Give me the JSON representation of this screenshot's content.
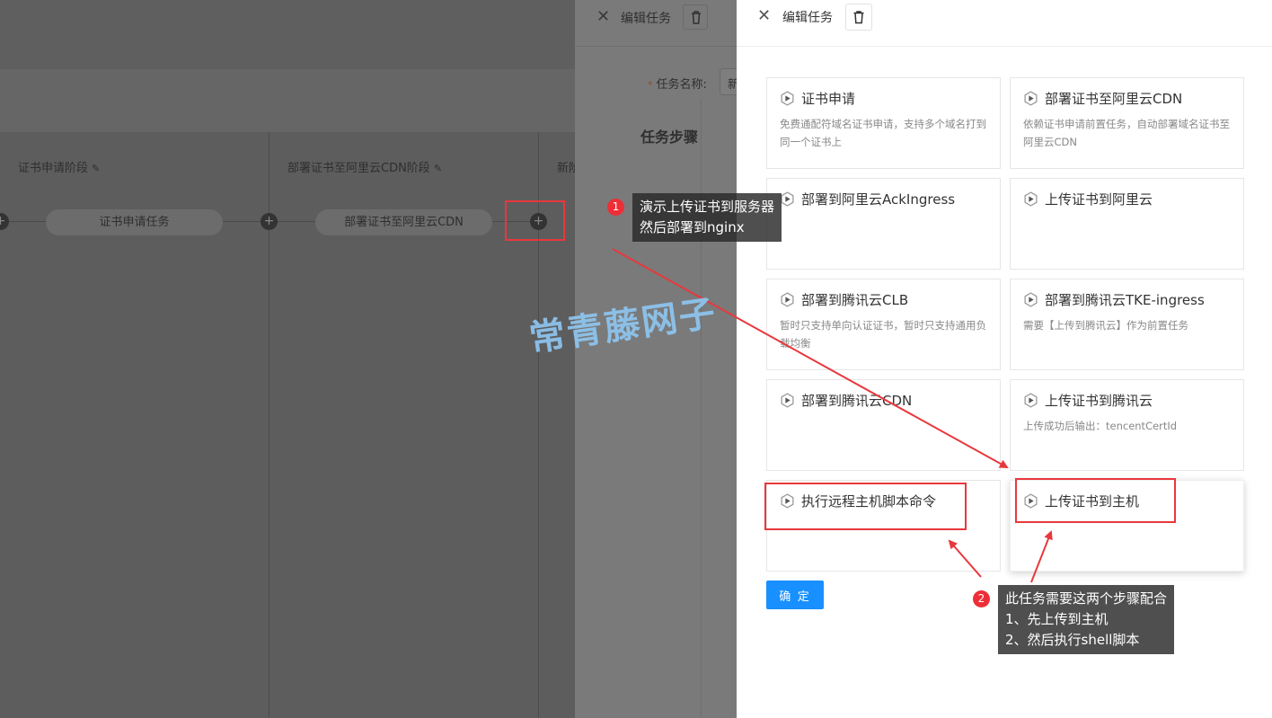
{
  "pipeline": {
    "stages": [
      {
        "title": "证书申请阶段",
        "node": "证书申请任务"
      },
      {
        "title": "部署证书至阿里云CDN阶段",
        "node": "部署证书至阿里云CDN"
      },
      {
        "title": "新阶段"
      }
    ],
    "add_symbol": "+",
    "edit_symbol": "✎"
  },
  "mid_drawer": {
    "title": "编辑任务",
    "task_name_label": "任务名称:",
    "task_name_value": "新",
    "steps_title": "任务步骤"
  },
  "drawer": {
    "title": "编辑任务",
    "cards": [
      {
        "title": "证书申请",
        "desc": "免费通配符域名证书申请，支持多个域名打到同一个证书上"
      },
      {
        "title": "部署证书至阿里云CDN",
        "desc": "依赖证书申请前置任务，自动部署域名证书至阿里云CDN"
      },
      {
        "title": "部署到阿里云AckIngress",
        "desc": ""
      },
      {
        "title": "上传证书到阿里云",
        "desc": ""
      },
      {
        "title": "部署到腾讯云CLB",
        "desc": "暂时只支持单向认证证书，暂时只支持通用负载均衡"
      },
      {
        "title": "部署到腾讯云TKE-ingress",
        "desc": "需要【上传到腾讯云】作为前置任务"
      },
      {
        "title": "部署到腾讯云CDN",
        "desc": ""
      },
      {
        "title": "上传证书到腾讯云",
        "desc": "上传成功后输出：tencentCertId"
      },
      {
        "title": "执行远程主机脚本命令",
        "desc": ""
      },
      {
        "title": "上传证书到主机",
        "desc": ""
      }
    ],
    "confirm_label": "确 定"
  },
  "annotations": {
    "note1_badge": "1",
    "note1_lines": [
      "演示上传证书到服务器",
      "然后部署到nginx"
    ],
    "note2_badge": "2",
    "note2_lines": [
      "此任务需要这两个步骤配合",
      "1、先上传到主机",
      "2、然后执行shell脚本"
    ],
    "watermark": "常青藤网子",
    "highlight_color": "#e8383d"
  },
  "colors": {
    "primary": "#1890ff",
    "annotation_red": "#ee2e37"
  }
}
